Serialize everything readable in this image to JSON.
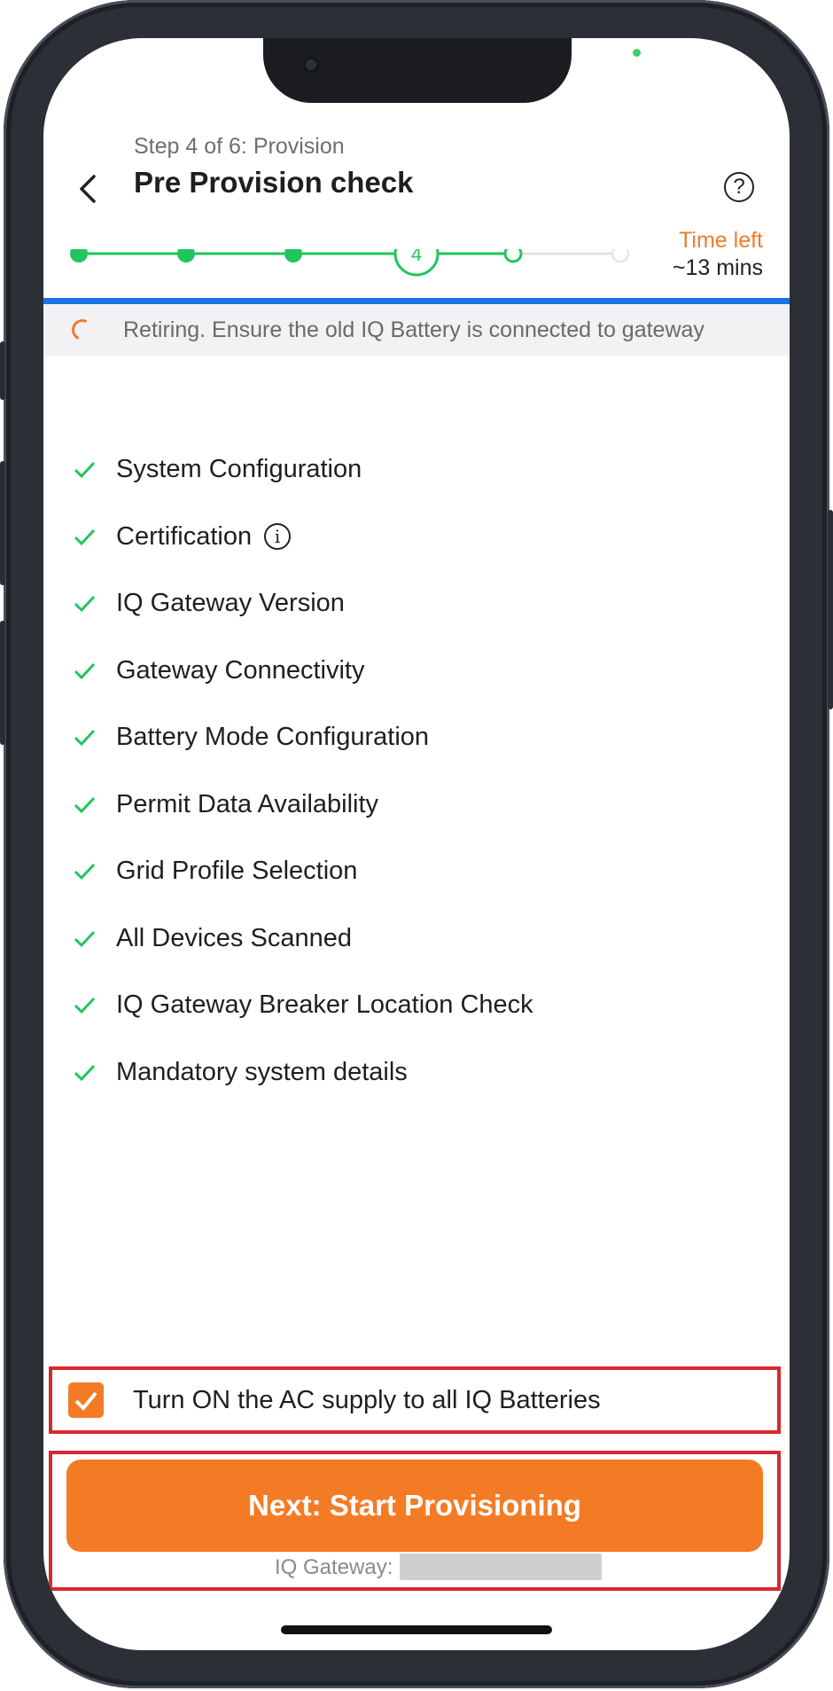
{
  "header": {
    "step_label": "Step 4 of 6: Provision",
    "title": "Pre Provision check",
    "time_left_label": "Time left",
    "time_left_value": "~13 mins"
  },
  "stepper": {
    "current_step": "4",
    "total_steps": 6,
    "active_color": "#21c55d",
    "inactive_color": "#e2e2e2"
  },
  "banner": {
    "text": "Retiring. Ensure the old IQ Battery is connected to gateway"
  },
  "checklist": [
    {
      "label": "System Configuration",
      "status": "done"
    },
    {
      "label": "Certification",
      "status": "done",
      "info": true
    },
    {
      "label": "IQ Gateway Version",
      "status": "done"
    },
    {
      "label": "Gateway Connectivity",
      "status": "done"
    },
    {
      "label": "Battery Mode Configuration",
      "status": "done"
    },
    {
      "label": "Permit Data Availability",
      "status": "done"
    },
    {
      "label": "Grid Profile Selection",
      "status": "done"
    },
    {
      "label": "All Devices Scanned",
      "status": "done"
    },
    {
      "label": "IQ Gateway Breaker Location Check",
      "status": "done"
    },
    {
      "label": "Mandatory system details",
      "status": "done"
    }
  ],
  "footer": {
    "ac_supply_label": "Turn ON the AC supply to all IQ Batteries",
    "ac_supply_checked": true,
    "next_button_label": "Next: Start Provisioning",
    "gateway_label": "IQ Gateway:"
  },
  "colors": {
    "accent": "#f47b25",
    "success": "#21c55d",
    "progress_bar": "#1a73e8",
    "highlight": "#d7282f"
  }
}
